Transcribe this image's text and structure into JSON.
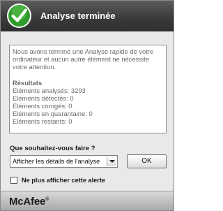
{
  "header": {
    "title": "Analyse terminée",
    "status_icon": "check-shield-icon",
    "icon_color": "#2e9a2b"
  },
  "message": {
    "text": "Nous avons terminé une Analyse rapide de votre ordinateur et aucun autre élément ne nécessite votre attention.",
    "results_heading": "Résultats",
    "results": [
      "Eléments analysés: 3293",
      "Eléments détectés: 0",
      "Eléments corrigés: 0",
      "Eléments en quarantaine: 0",
      "Eléments restants: 0"
    ]
  },
  "prompt": {
    "question": "Que souhaitez-vous faire ?",
    "selected_action": "Afficher les détails de l'analyse",
    "ok_label": "OK",
    "dont_show_label": "Ne plus afficher cette alerte",
    "dont_show_checked": false
  },
  "footer": {
    "brand": "McAfee",
    "trademark": "®"
  }
}
